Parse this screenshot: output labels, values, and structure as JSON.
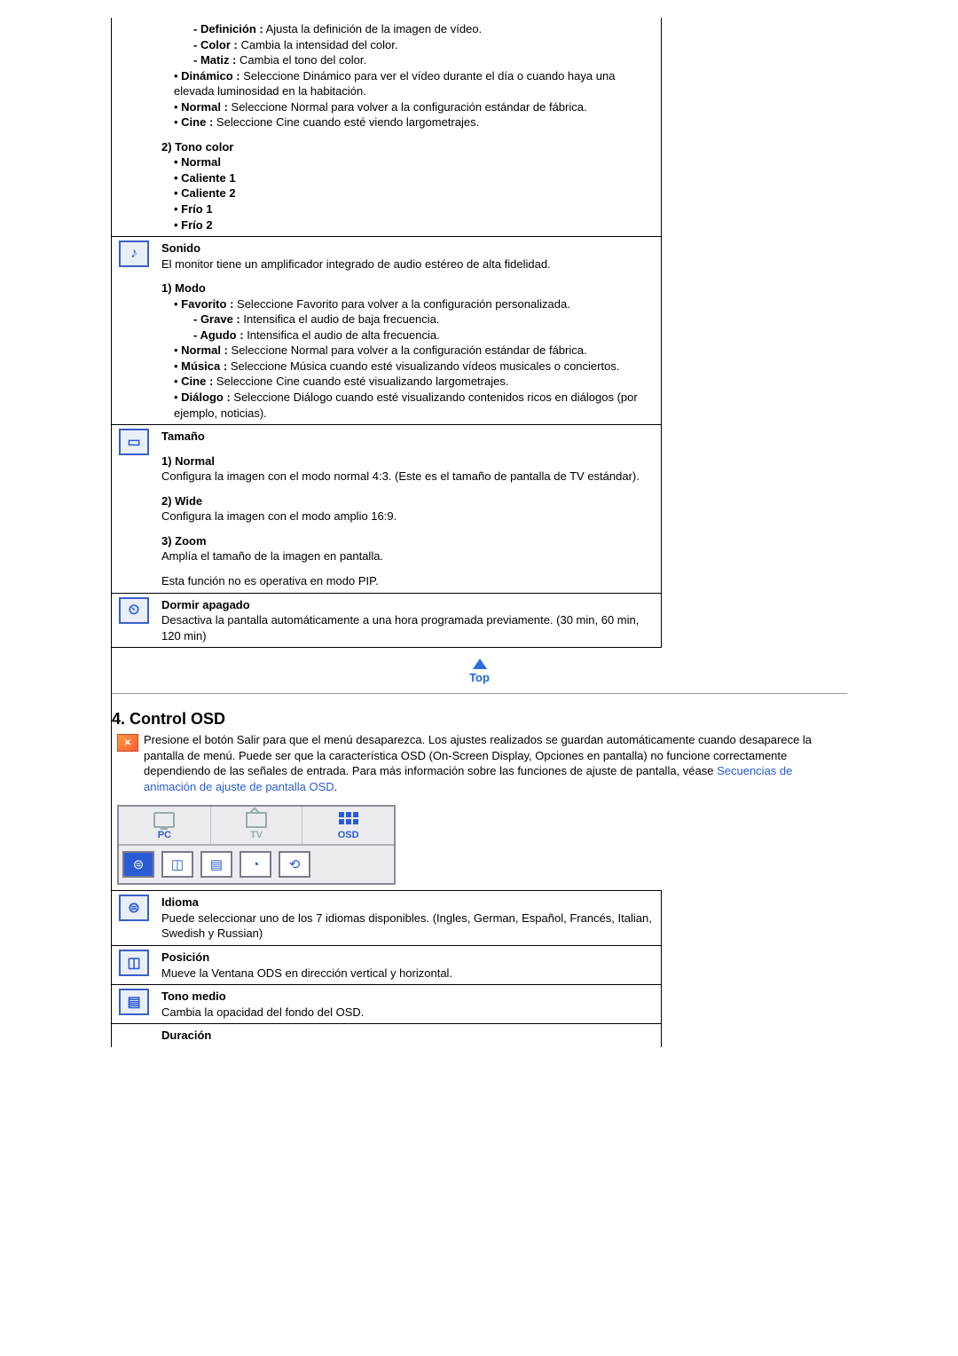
{
  "imagen": {
    "definicion_label": "- Definición :",
    "definicion_text": "Ajusta la definición de la imagen de vídeo.",
    "color_label": "- Color :",
    "color_text": "Cambia la intensidad del color.",
    "matiz_label": "- Matiz :",
    "matiz_text": "Cambia el tono del color.",
    "dinamico_label": "Dinámico :",
    "dinamico_text": "Seleccione Dinámico para ver el vídeo durante el día o cuando haya una elevada luminosidad en la habitación.",
    "normal_label": "Normal :",
    "normal_text": "Seleccione Normal para volver a la configuración estándar de fábrica.",
    "cine_label": "Cine :",
    "cine_text": "Seleccione Cine cuando esté viendo largometrajes.",
    "tono_color_heading": "2) Tono color",
    "tono_items": [
      "Normal",
      "Caliente 1",
      "Caliente 2",
      "Frío 1",
      "Frío 2"
    ]
  },
  "sonido": {
    "title": "Sonido",
    "intro": "El monitor tiene un amplificador integrado de audio estéreo de alta fidelidad.",
    "modo_heading": "1) Modo",
    "favorito_label": "Favorito :",
    "favorito_text": "Seleccione Favorito para volver a la configuración personalizada.",
    "grave_label": "- Grave :",
    "grave_text": "Intensifica el audio de baja frecuencia.",
    "agudo_label": "- Agudo :",
    "agudo_text": "Intensifica el audio de alta frecuencia.",
    "normal_label": "Normal :",
    "normal_text": "Seleccione Normal para volver a la configuración estándar de fábrica.",
    "musica_label": "Música :",
    "musica_text": "Seleccione Música cuando esté visualizando vídeos musicales o conciertos.",
    "cine_label": "Cine :",
    "cine_text": "Seleccione Cine cuando esté visualizando largometrajes.",
    "dialogo_label": "Diálogo :",
    "dialogo_text": "Seleccione Diálogo cuando esté visualizando contenidos ricos en diálogos (por ejemplo, noticias)."
  },
  "tamano": {
    "title": "Tamaño",
    "normal_heading": "1) Normal",
    "normal_text": "Configura la imagen con el modo normal 4:3. (Este es el tamaño de pantalla de TV estándar).",
    "wide_heading": "2) Wide",
    "wide_text": "Configura la imagen con el modo amplio 16:9.",
    "zoom_heading": "3) Zoom",
    "zoom_text": "Amplía el tamaño de la imagen en pantalla.",
    "note": "Esta función no es operativa en modo PIP."
  },
  "dormir": {
    "title": "Dormir apagado",
    "text": "Desactiva la pantalla automáticamente a una hora programada previamente. (30 min, 60 min, 120 min)"
  },
  "top_label": "Top",
  "osd": {
    "heading": "4. Control OSD",
    "intro_part1": "Presione el botón Salir para que el menú desaparezca. Los ajustes realizados se guardan automáticamente cuando desaparece la pantalla de menú. Puede ser que la característica OSD (On-Screen Display, Opciones en pantalla) no funcione correctamente dependiendo de las señales de entrada. Para más información sobre las funciones de ajuste de pantalla, véase ",
    "link_text": "Secuencias de animación de ajuste de pantalla OSD",
    "intro_part2": ".",
    "tabs": {
      "pc": "PC",
      "tv": "TV",
      "osd": "OSD"
    },
    "idioma_title": "Idioma",
    "idioma_text": "Puede seleccionar uno de los 7 idiomas disponibles. (Ingles, German, Español, Francés, Italian, Swedish y Russian)",
    "posicion_title": "Posición",
    "posicion_text": "Mueve la Ventana ODS en dirección vertical y horizontal.",
    "tono_title": "Tono medio",
    "tono_text": "Cambia la opacidad del fondo del OSD.",
    "duracion_title": "Duración"
  }
}
